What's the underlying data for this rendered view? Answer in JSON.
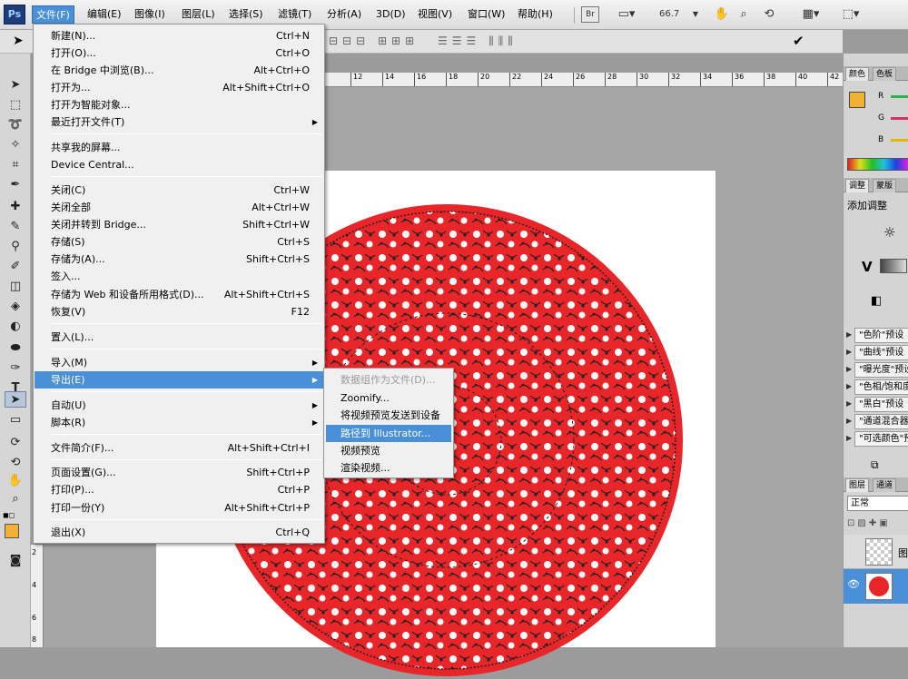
{
  "app": {
    "logo": "Ps"
  },
  "menubar": {
    "items": [
      {
        "label": "文件(F)"
      },
      {
        "label": "编辑(E)"
      },
      {
        "label": "图像(I)"
      },
      {
        "label": "图层(L)"
      },
      {
        "label": "选择(S)"
      },
      {
        "label": "滤镜(T)"
      },
      {
        "label": "分析(A)"
      },
      {
        "label": "3D(D)"
      },
      {
        "label": "视图(V)"
      },
      {
        "label": "窗口(W)"
      },
      {
        "label": "帮助(H)"
      }
    ],
    "bridge_button": "Br",
    "zoom": "66.7"
  },
  "file_menu": {
    "items": [
      {
        "label": "新建(N)...",
        "shortcut": "Ctrl+N"
      },
      {
        "label": "打开(O)...",
        "shortcut": "Ctrl+O"
      },
      {
        "label": "在 Bridge 中浏览(B)...",
        "shortcut": "Alt+Ctrl+O"
      },
      {
        "label": "打开为...",
        "shortcut": "Alt+Shift+Ctrl+O"
      },
      {
        "label": "打开为智能对象...",
        "shortcut": ""
      },
      {
        "label": "最近打开文件(T)",
        "shortcut": ""
      },
      {
        "label": "共享我的屏幕...",
        "shortcut": ""
      },
      {
        "label": "Device Central...",
        "shortcut": ""
      },
      {
        "label": "关闭(C)",
        "shortcut": "Ctrl+W"
      },
      {
        "label": "关闭全部",
        "shortcut": "Alt+Ctrl+W"
      },
      {
        "label": "关闭并转到 Bridge...",
        "shortcut": "Shift+Ctrl+W"
      },
      {
        "label": "存储(S)",
        "shortcut": "Ctrl+S"
      },
      {
        "label": "存储为(A)...",
        "shortcut": "Shift+Ctrl+S"
      },
      {
        "label": "签入...",
        "shortcut": ""
      },
      {
        "label": "存储为 Web 和设备所用格式(D)...",
        "shortcut": "Alt+Shift+Ctrl+S"
      },
      {
        "label": "恢复(V)",
        "shortcut": "F12"
      },
      {
        "label": "置入(L)...",
        "shortcut": ""
      },
      {
        "label": "导入(M)",
        "shortcut": ""
      },
      {
        "label": "导出(E)",
        "shortcut": ""
      },
      {
        "label": "自动(U)",
        "shortcut": ""
      },
      {
        "label": "脚本(R)",
        "shortcut": ""
      },
      {
        "label": "文件简介(F)...",
        "shortcut": "Alt+Shift+Ctrl+I"
      },
      {
        "label": "页面设置(G)...",
        "shortcut": "Shift+Ctrl+P"
      },
      {
        "label": "打印(P)...",
        "shortcut": "Ctrl+P"
      },
      {
        "label": "打印一份(Y)",
        "shortcut": "Alt+Shift+Ctrl+P"
      },
      {
        "label": "退出(X)",
        "shortcut": "Ctrl+Q"
      }
    ]
  },
  "export_submenu": {
    "items": [
      {
        "label": "数据组作为文件(D)..."
      },
      {
        "label": "Zoomify..."
      },
      {
        "label": "将视频预览发送到设备"
      },
      {
        "label": "路径到 Illustrator..."
      },
      {
        "label": "视频预览"
      },
      {
        "label": "渲染视频..."
      }
    ]
  },
  "ruler": {
    "ticks": [
      "12",
      "14",
      "16",
      "18",
      "20",
      "22",
      "24",
      "26",
      "28",
      "30",
      "32",
      "34",
      "36",
      "38",
      "40",
      "42"
    ],
    "vticks": [
      "2",
      "4",
      "6",
      "8"
    ]
  },
  "panels": {
    "color_tabs": [
      "颜色",
      "色板"
    ],
    "channels": [
      "R",
      "G",
      "B"
    ],
    "adjust_tabs": [
      "调整",
      "蒙版"
    ],
    "adjust_title": "添加调整",
    "presets": [
      "\"色阶\"预设",
      "\"曲线\"预设",
      "\"曝光度\"预设",
      "\"色相/饱和度\"预设",
      "\"黑白\"预设",
      "\"通道混合器\"预设",
      "\"可选颜色\"预设"
    ],
    "layers_tabs": [
      "图层",
      "通道"
    ],
    "blend_mode": "正常",
    "layer_label": "图"
  },
  "colors": {
    "accent": "#4a90d9",
    "art_red": "#e8262a"
  }
}
